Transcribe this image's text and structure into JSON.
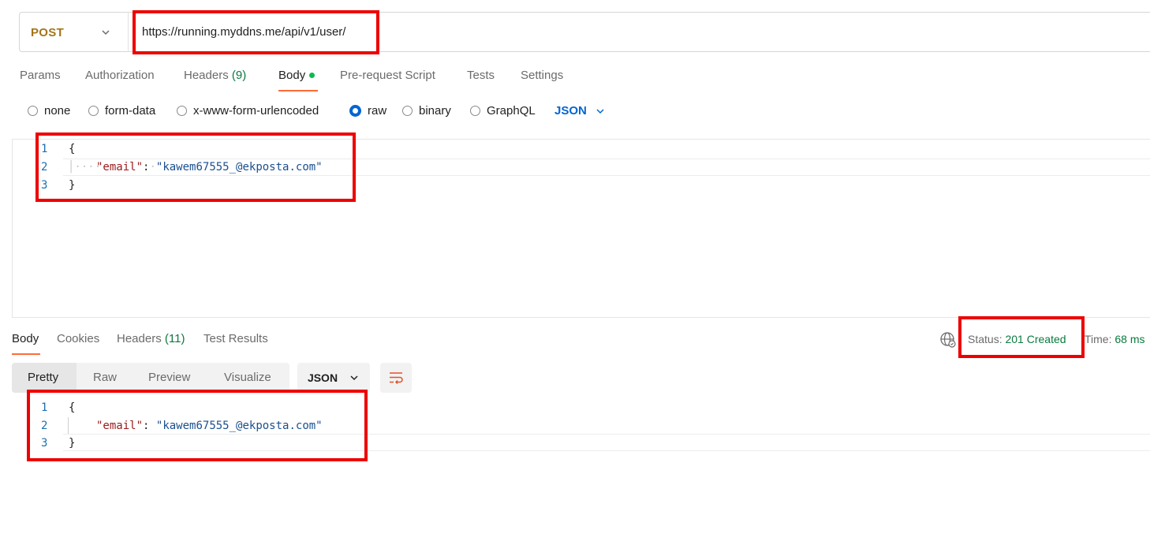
{
  "request": {
    "method": "POST",
    "url": "https://running.myddns.me/api/v1/user/",
    "tabs": [
      {
        "label": "Params"
      },
      {
        "label": "Authorization"
      },
      {
        "label": "Headers",
        "count": "(9)"
      },
      {
        "label": "Body"
      },
      {
        "label": "Pre-request Script"
      },
      {
        "label": "Tests"
      },
      {
        "label": "Settings"
      }
    ],
    "body_types": [
      "none",
      "form-data",
      "x-www-form-urlencoded",
      "raw",
      "binary",
      "GraphQL"
    ],
    "selected_body_type": "raw",
    "format": "JSON",
    "editor": {
      "line_numbers": [
        "1",
        "2",
        "3"
      ],
      "open": "{",
      "key": "\"email\"",
      "colon": ":",
      "value": "\"kawem67555_@ekposta.com\"",
      "close": "}"
    }
  },
  "response": {
    "tabs": [
      {
        "label": "Body"
      },
      {
        "label": "Cookies"
      },
      {
        "label": "Headers",
        "count": "(11)"
      },
      {
        "label": "Test Results"
      }
    ],
    "status_label": "Status:",
    "status_value": "201 Created",
    "time_label": "Time:",
    "time_value": "68 ms",
    "views": [
      "Pretty",
      "Raw",
      "Preview",
      "Visualize"
    ],
    "format": "JSON",
    "body": {
      "line_numbers": [
        "1",
        "2",
        "3"
      ],
      "open": "{",
      "key": "\"email\"",
      "colon": ":",
      "value": "\"kawem67555_@ekposta.com\"",
      "close": "}"
    }
  },
  "colors": {
    "accent": "#ff6c37",
    "method": "#a37518",
    "link_blue": "#0265d2",
    "success_green": "#0a7a3e",
    "highlight_red": "#ee0000"
  },
  "icons": [
    "chevron-down-icon",
    "globe-icon",
    "wrap-lines-icon"
  ]
}
